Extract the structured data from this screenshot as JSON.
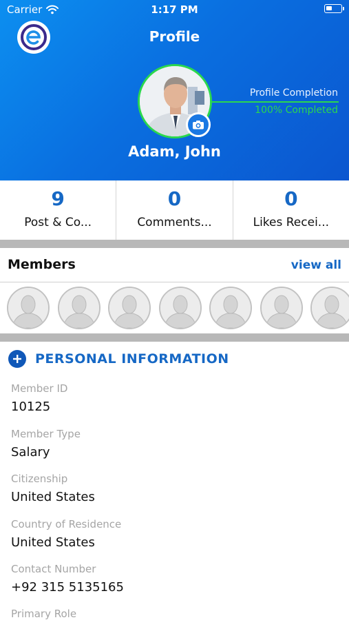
{
  "status_bar": {
    "carrier": "Carrier",
    "time": "1:17 PM"
  },
  "nav": {
    "title": "Profile"
  },
  "profile": {
    "completion_title": "Profile Completion",
    "completion_status": "100% Completed",
    "completion_percent": 100,
    "name": "Adam, John"
  },
  "stats": [
    {
      "value": "9",
      "label": "Post & Co..."
    },
    {
      "value": "0",
      "label": "Comments..."
    },
    {
      "value": "0",
      "label": "Likes Recei..."
    }
  ],
  "members": {
    "title": "Members",
    "view_all": "view all",
    "avatar_count": 7
  },
  "personal_info": {
    "title": "PERSONAL INFORMATION",
    "fields": [
      {
        "label": "Member ID",
        "value": "10125"
      },
      {
        "label": "Member Type",
        "value": "Salary"
      },
      {
        "label": "Citizenship",
        "value": "United States"
      },
      {
        "label": "Country of Residence",
        "value": "United States"
      },
      {
        "label": "Contact Number",
        "value": "+92 315 5135165"
      },
      {
        "label": "Primary Role",
        "value": ""
      }
    ]
  },
  "colors": {
    "header_start": "#0c8ff0",
    "header_end": "#0b56cf",
    "accent_blue": "#1668c5",
    "completion_green": "#2bd84d"
  },
  "icons": {
    "wifi": "wifi-icon",
    "battery": "battery-icon",
    "logo": "app-logo-icon",
    "camera": "camera-icon",
    "plus": "plus-icon",
    "member": "member-placeholder-icon"
  }
}
